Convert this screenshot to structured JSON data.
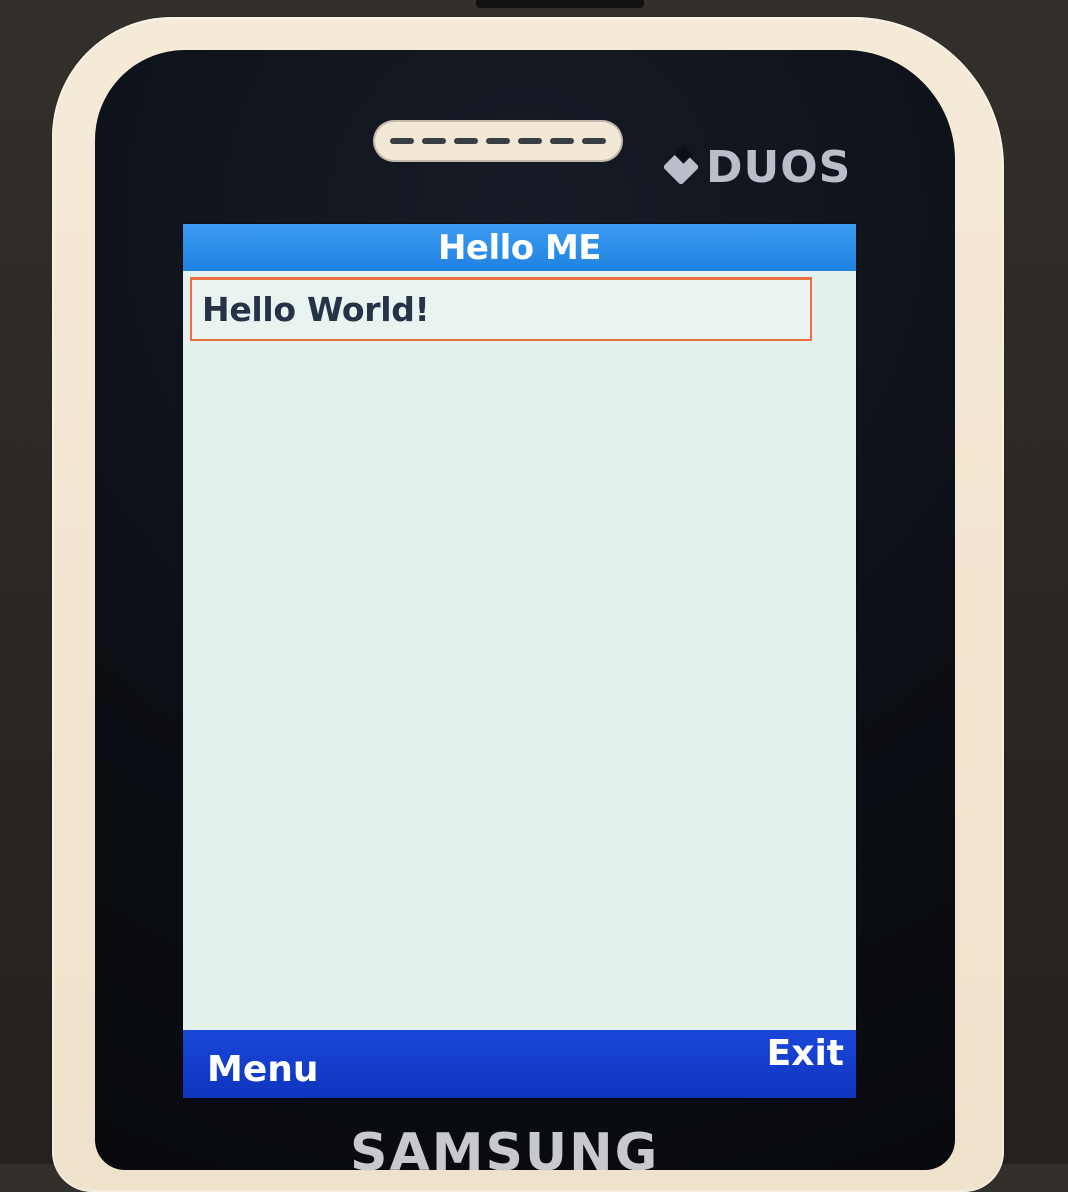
{
  "device": {
    "brand": "SAMSUNG",
    "badge": "DUOS",
    "shell_color": "#efe2cb",
    "face_color": "#0c0f15",
    "screen_bg": "#e4f1ef"
  },
  "app": {
    "title": "Hello ME",
    "title_bar_color": "#1f82e0"
  },
  "content": {
    "message": "Hello World!",
    "focus_color": "#ea6f42"
  },
  "softkeys": {
    "left": "Menu",
    "right": "Exit",
    "bar_color": "#1341c9"
  },
  "icons": {
    "speaker": "speaker-grille-icon",
    "sim": "sim-card-icon"
  }
}
